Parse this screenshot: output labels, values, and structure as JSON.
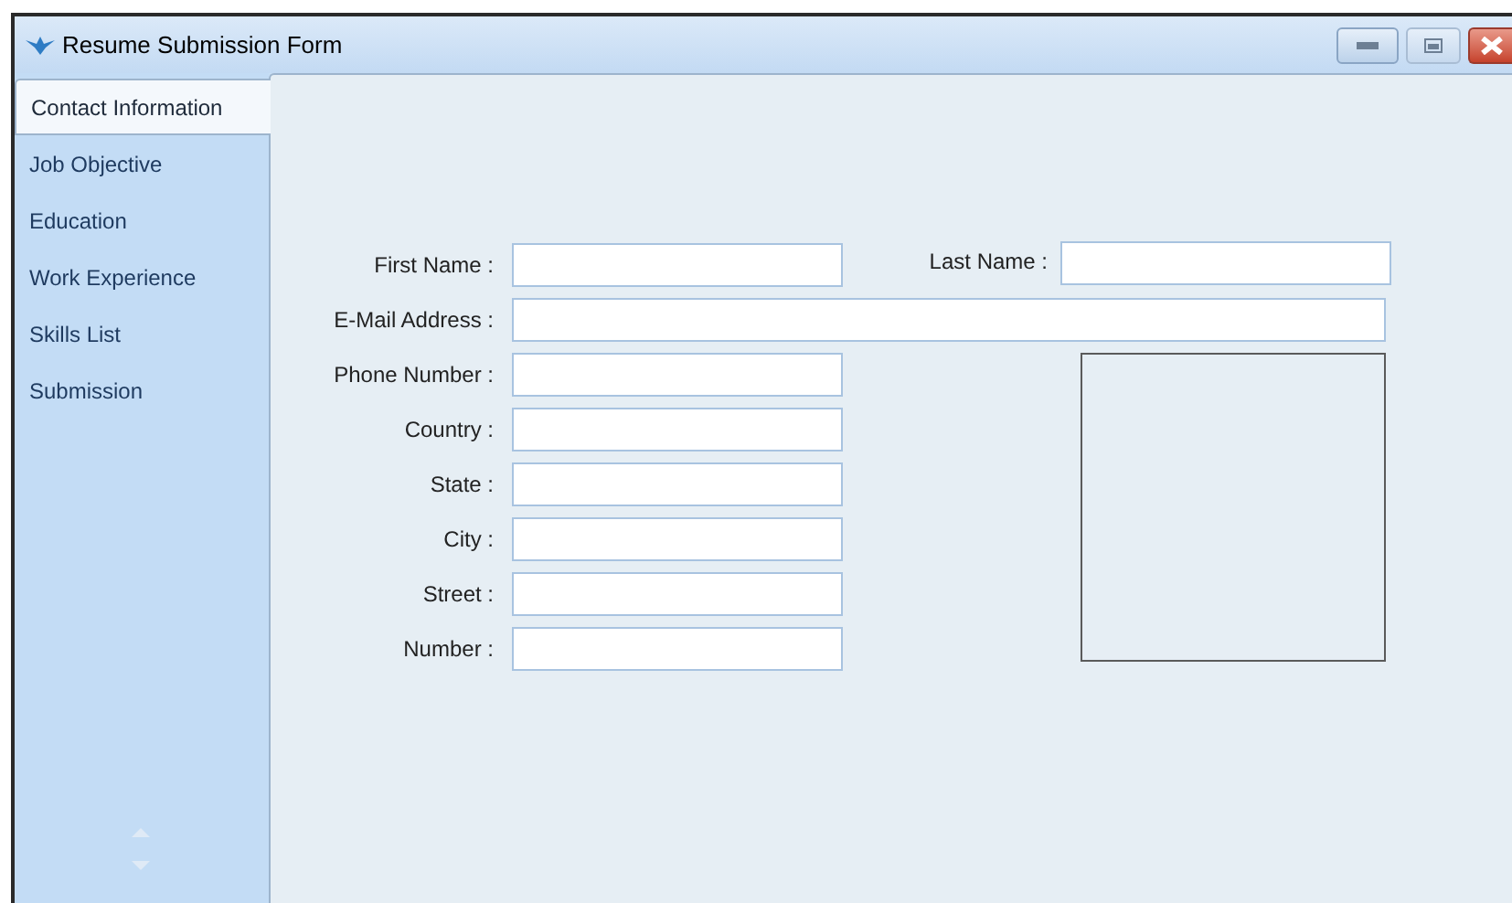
{
  "window": {
    "title": "Resume Submission Form"
  },
  "tabs": [
    {
      "label": "Contact Information",
      "selected": true
    },
    {
      "label": "Job Objective",
      "selected": false
    },
    {
      "label": "Education",
      "selected": false
    },
    {
      "label": "Work Experience",
      "selected": false
    },
    {
      "label": "Skills List",
      "selected": false
    },
    {
      "label": "Submission",
      "selected": false
    }
  ],
  "form": {
    "first_name": {
      "label": "First Name :"
    },
    "last_name": {
      "label": "Last Name :"
    },
    "email": {
      "label": "E-Mail Address :"
    },
    "address_fields": [
      {
        "label": "Phone Number :"
      },
      {
        "label": "Country :"
      },
      {
        "label": "State :"
      },
      {
        "label": "City :"
      },
      {
        "label": "Street :"
      },
      {
        "label": "Number :"
      }
    ]
  }
}
